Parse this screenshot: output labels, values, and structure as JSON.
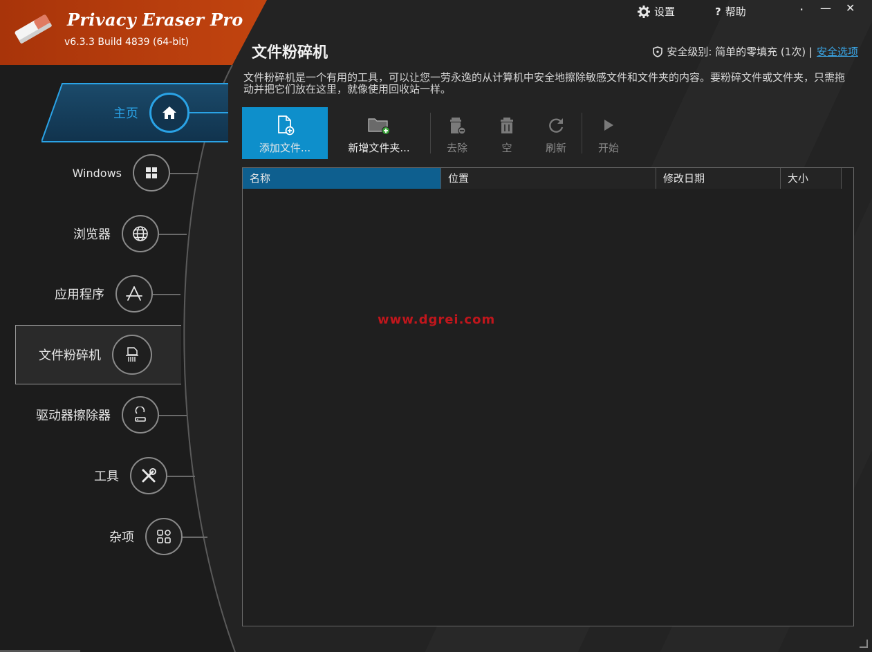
{
  "app": {
    "name": "Privacy Eraser Pro",
    "version": "v6.3.3 Build 4839 (64-bit)"
  },
  "titlebar": {
    "settings_label": "设置",
    "help_label": "帮助",
    "minimize_glyph": "—",
    "close_glyph": "✕",
    "dot_glyph": "·"
  },
  "page": {
    "title": "文件粉碎机",
    "security_label": "安全级别: 简单的零填充 (1次) |",
    "security_link": "安全选项",
    "description": "文件粉碎机是一个有用的工具，可以让您一劳永逸的从计算机中安全地擦除敏感文件和文件夹的内容。要粉碎文件或文件夹，只需拖动并把它们放在这里，就像使用回收站一样。"
  },
  "sidebar": {
    "items": [
      {
        "label": "主页",
        "icon": "home-icon"
      },
      {
        "label": "Windows",
        "icon": "windows-icon"
      },
      {
        "label": "浏览器",
        "icon": "globe-icon"
      },
      {
        "label": "应用程序",
        "icon": "app-store-icon"
      },
      {
        "label": "文件粉碎机",
        "icon": "shredder-icon"
      },
      {
        "label": "驱动器擦除器",
        "icon": "drive-wiper-icon"
      },
      {
        "label": "工具",
        "icon": "tools-icon"
      },
      {
        "label": "杂项",
        "icon": "grid-icon"
      }
    ]
  },
  "toolbar": {
    "add_file": "添加文件...",
    "new_folder": "新增文件夹...",
    "remove": "去除",
    "empty": "空",
    "refresh": "刷新",
    "start": "开始"
  },
  "table": {
    "columns": [
      "名称",
      "位置",
      "修改日期",
      "大小"
    ],
    "rows": []
  },
  "watermark": "www.dgrei.com",
  "colors": {
    "brand": "#c2440f",
    "accent": "#0e8fcb",
    "link": "#3aa7e8",
    "background": "#222222"
  }
}
